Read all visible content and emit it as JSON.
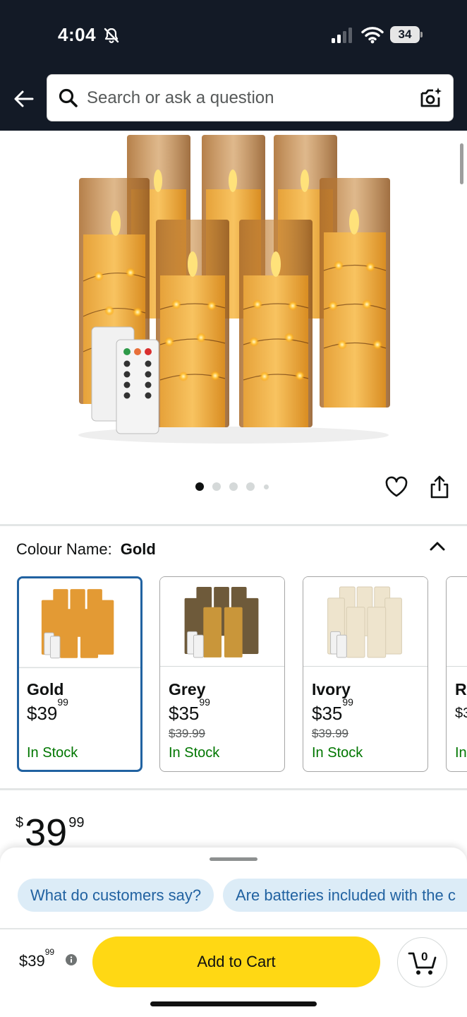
{
  "status_bar": {
    "time": "4:04",
    "battery": "34"
  },
  "search": {
    "placeholder": "Search or ask a question"
  },
  "gallery": {
    "total_images": 5,
    "active_index": 0
  },
  "variation": {
    "label": "Colour Name:",
    "selected": "Gold",
    "options": [
      {
        "name": "Gold",
        "price_whole": "$39",
        "price_fraction": "99",
        "was_price": "",
        "availability": "In Stock"
      },
      {
        "name": "Grey",
        "price_whole": "$35",
        "price_fraction": "99",
        "was_price": "$39.99",
        "availability": "In Stock"
      },
      {
        "name": "Ivory",
        "price_whole": "$35",
        "price_fraction": "99",
        "was_price": "$39.99",
        "availability": "In Stock"
      },
      {
        "name": "R",
        "price_whole": "$3",
        "price_fraction": "",
        "was_price": "",
        "availability": "In"
      }
    ]
  },
  "price": {
    "currency": "$",
    "whole": "39",
    "fraction": "99"
  },
  "bottom_sheet": {
    "chips": [
      "What do customers say?",
      "Are batteries included with the c"
    ],
    "price_whole": "$39",
    "price_fraction": "99",
    "add_to_cart_label": "Add to Cart",
    "cart_count": "0"
  },
  "colors": {
    "header_bg": "#131a26",
    "cart_button": "#ffd814",
    "link_blue": "#2162a1",
    "in_stock_green": "#007600",
    "chip_bg": "#dcecf7"
  },
  "icons": [
    "bell-muted-icon",
    "signal-icon",
    "wifi-icon",
    "battery-icon",
    "back-arrow-icon",
    "search-icon",
    "camera-search-icon",
    "heart-icon",
    "share-icon",
    "chevron-up-icon",
    "info-icon",
    "cart-icon"
  ]
}
